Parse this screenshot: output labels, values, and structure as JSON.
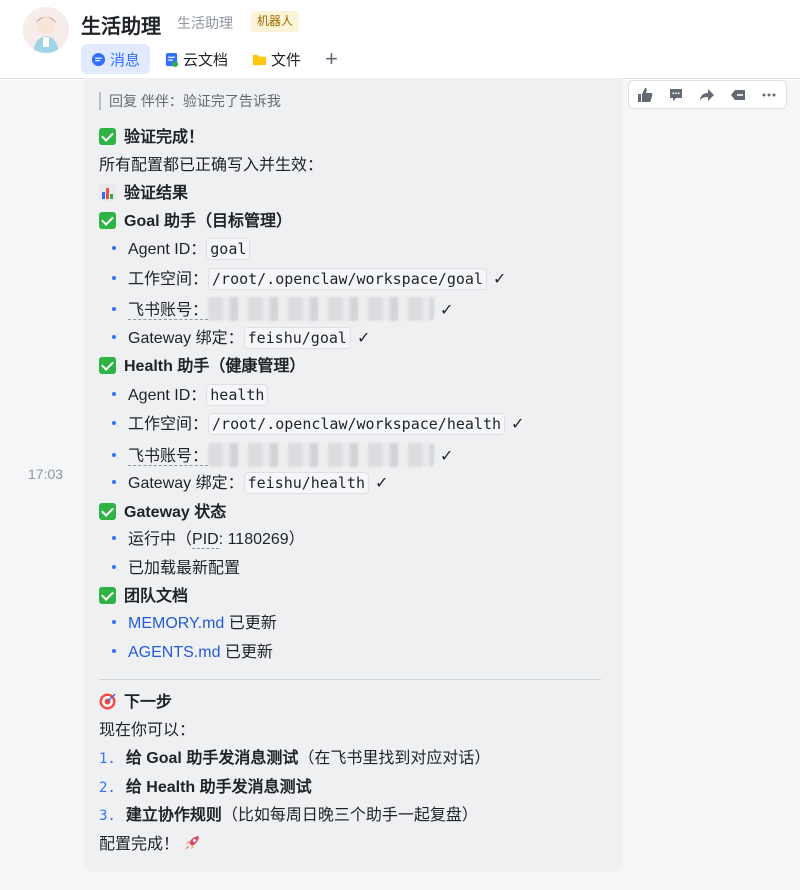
{
  "header": {
    "title": "生活助理",
    "subtitle": "生活助理",
    "badge": "机器人",
    "tabs": [
      {
        "label": "消息",
        "icon": "message-icon",
        "active": true
      },
      {
        "label": "云文档",
        "icon": "cloud-doc-icon",
        "active": false
      },
      {
        "label": "文件",
        "icon": "folder-icon",
        "active": false
      }
    ],
    "add_tab": "+"
  },
  "message": {
    "time": "17:03",
    "reply_quote": "回复 伴伴：验证完了告诉我",
    "verify_title": "验证完成！",
    "verify_desc": "所有配置都已正确写入并生效：",
    "results_title": "验证结果",
    "goal": {
      "title": "Goal 助手（目标管理）",
      "agent_id_label": "Agent ID：",
      "agent_id": "goal",
      "workspace_label": "工作空间：",
      "workspace": "/root/.openclaw/workspace/goal",
      "feishu_label": "飞书账号：",
      "gateway_label": "Gateway 绑定：",
      "gateway": "feishu/goal",
      "check": "✓"
    },
    "health": {
      "title": "Health 助手（健康管理）",
      "agent_id_label": "Agent ID：",
      "agent_id": "health",
      "workspace_label": "工作空间：",
      "workspace": "/root/.openclaw/workspace/health",
      "feishu_label": "飞书账号：",
      "gateway_label": "Gateway 绑定：",
      "gateway": "feishu/health",
      "check": "✓"
    },
    "gateway_status": {
      "title": "Gateway 状态",
      "running_prefix": "运行中（",
      "pid_label": "PID",
      "running_suffix": ": 1180269）",
      "loaded": "已加载最新配置"
    },
    "team_docs": {
      "title": "团队文档",
      "memory_link": "MEMORY.md",
      "memory_status": " 已更新",
      "agents_link": "AGENTS.md",
      "agents_status": " 已更新"
    },
    "next_step": {
      "title": "下一步",
      "intro": "现在你可以：",
      "items": [
        {
          "num": "1.",
          "bold": "给 Goal 助手发消息测试",
          "rest": "（在飞书里找到对应对话）"
        },
        {
          "num": "2.",
          "bold": "给 Health 助手发消息测试",
          "rest": ""
        },
        {
          "num": "3.",
          "bold": "建立协作规则",
          "rest": "（比如每周日晚三个助手一起复盘）"
        }
      ],
      "done": "配置完成！"
    }
  },
  "actions": [
    {
      "name": "thumbs-up-icon"
    },
    {
      "name": "reply-comment-icon"
    },
    {
      "name": "forward-icon"
    },
    {
      "name": "quote-icon"
    },
    {
      "name": "more-icon"
    }
  ],
  "colors": {
    "accent": "#3370ff",
    "check_green": "#2fb344",
    "bubble_bg": "#eff0f1"
  }
}
